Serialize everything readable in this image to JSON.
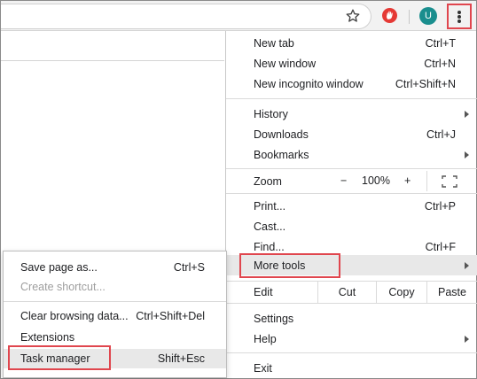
{
  "toolbar": {
    "avatar_initial": "U"
  },
  "menu": {
    "new_tab": {
      "label": "New tab",
      "shortcut": "Ctrl+T"
    },
    "new_window": {
      "label": "New window",
      "shortcut": "Ctrl+N"
    },
    "new_incognito": {
      "label": "New incognito window",
      "shortcut": "Ctrl+Shift+N"
    },
    "history": {
      "label": "History"
    },
    "downloads": {
      "label": "Downloads",
      "shortcut": "Ctrl+J"
    },
    "bookmarks": {
      "label": "Bookmarks"
    },
    "zoom": {
      "label": "Zoom",
      "minus": "−",
      "value": "100%",
      "plus": "+"
    },
    "print": {
      "label": "Print...",
      "shortcut": "Ctrl+P"
    },
    "cast": {
      "label": "Cast..."
    },
    "find": {
      "label": "Find...",
      "shortcut": "Ctrl+F"
    },
    "more_tools": {
      "label": "More tools"
    },
    "edit": {
      "label": "Edit",
      "cut": "Cut",
      "copy": "Copy",
      "paste": "Paste"
    },
    "settings": {
      "label": "Settings"
    },
    "help": {
      "label": "Help"
    },
    "exit": {
      "label": "Exit"
    }
  },
  "submenu": {
    "save_page": {
      "label": "Save page as...",
      "shortcut": "Ctrl+S"
    },
    "create_shortcut": {
      "label": "Create shortcut..."
    },
    "clear_browsing": {
      "label": "Clear browsing data...",
      "shortcut": "Ctrl+Shift+Del"
    },
    "extensions": {
      "label": "Extensions"
    },
    "task_manager": {
      "label": "Task manager",
      "shortcut": "Shift+Esc"
    }
  },
  "colors": {
    "highlight_box": "#e0464e",
    "hover_row": "#e8e8e8",
    "avatar": "#1a8e8e",
    "extension": "#e53935"
  },
  "icons": [
    "star-icon",
    "extension-icon",
    "kebab-menu-icon",
    "fullscreen-icon",
    "submenu-arrow-icon"
  ]
}
